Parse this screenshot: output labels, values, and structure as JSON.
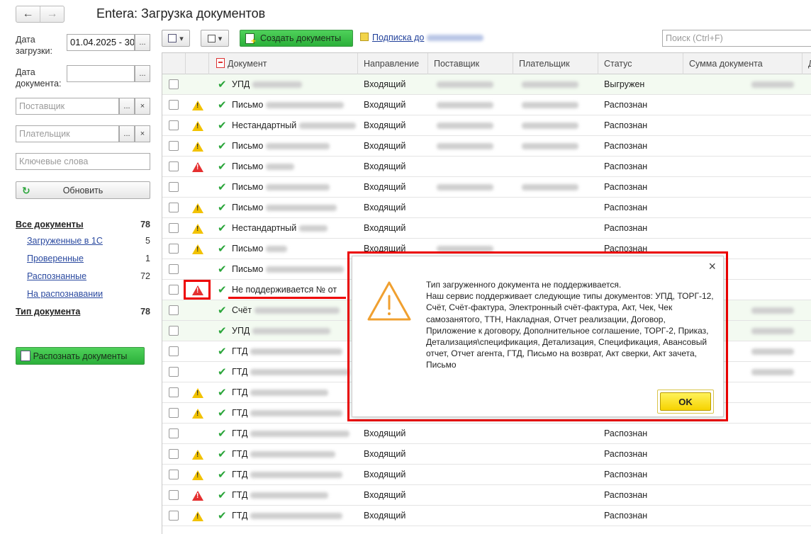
{
  "app": {
    "title": "Entera: Загрузка документов"
  },
  "filters": {
    "upload_date_label": "Дата загрузки:",
    "upload_date_value": "01.04.2025 - 30",
    "doc_date_label": "Дата документа:",
    "doc_date_value": "",
    "supplier_placeholder": "Поставщик",
    "payer_placeholder": "Плательщик",
    "keywords_placeholder": "Ключевые слова",
    "refresh_label": "Обновить",
    "ellipsis": "...",
    "clear": "×"
  },
  "nav": {
    "all_docs": {
      "label": "Все документы",
      "count": "78"
    },
    "items": [
      {
        "label": "Загруженные в 1С",
        "count": "5"
      },
      {
        "label": "Проверенные",
        "count": "1"
      },
      {
        "label": "Распознанные",
        "count": "72"
      },
      {
        "label": "На распознавании",
        "count": ""
      }
    ],
    "doc_type": {
      "label": "Тип документа",
      "count": "78"
    },
    "recognize_label": "Распознать документы"
  },
  "toolbar": {
    "create_label": "Создать документы",
    "subscription_label": "Подписка до",
    "search_placeholder": "Поиск (Ctrl+F)"
  },
  "grid": {
    "columns": [
      "Документ",
      "Направление",
      "Поставщик",
      "Плательщик",
      "Статус",
      "Сумма документа",
      "Д"
    ],
    "rows": [
      {
        "icon": "",
        "doc": "УПД",
        "direction": "Входящий",
        "status": "Выгружен",
        "green": true
      },
      {
        "icon": "warn",
        "doc": "Письмо",
        "direction": "Входящий",
        "status": "Распознан",
        "green": false
      },
      {
        "icon": "warn",
        "doc": "Нестандартный",
        "direction": "Входящий",
        "status": "Распознан",
        "green": false
      },
      {
        "icon": "warn",
        "doc": "Письмо",
        "direction": "Входящий",
        "status": "Распознан",
        "green": false
      },
      {
        "icon": "err",
        "doc": "Письмо",
        "direction": "Входящий",
        "status": "Распознан",
        "green": false
      },
      {
        "icon": "",
        "doc": "Письмо",
        "direction": "Входящий",
        "status": "Распознан",
        "green": false
      },
      {
        "icon": "warn",
        "doc": "Письмо",
        "direction": "Входящий",
        "status": "Распознан",
        "green": false
      },
      {
        "icon": "warn",
        "doc": "Нестандартный",
        "direction": "Входящий",
        "status": "Распознан",
        "green": false
      },
      {
        "icon": "warn",
        "doc": "Письмо",
        "direction": "Входящий",
        "status": "Распознан",
        "green": false
      },
      {
        "icon": "",
        "doc": "Письмо",
        "direction": "",
        "status": "",
        "green": false
      },
      {
        "icon": "err",
        "doc": "Не поддерживается № от",
        "direction": "",
        "status": "",
        "green": false
      },
      {
        "icon": "",
        "doc": "Счёт",
        "direction": "",
        "status": "",
        "green": true
      },
      {
        "icon": "",
        "doc": "УПД",
        "direction": "",
        "status": "",
        "green": true
      },
      {
        "icon": "",
        "doc": "ГТД",
        "direction": "",
        "status": "",
        "green": false
      },
      {
        "icon": "",
        "doc": "ГТД",
        "direction": "",
        "status": "",
        "green": false
      },
      {
        "icon": "warn",
        "doc": "ГТД",
        "direction": "",
        "status": "",
        "green": false
      },
      {
        "icon": "warn",
        "doc": "ГТД",
        "direction": "",
        "status": "",
        "green": false
      },
      {
        "icon": "",
        "doc": "ГТД",
        "direction": "Входящий",
        "status": "Распознан",
        "green": false
      },
      {
        "icon": "warn",
        "doc": "ГТД",
        "direction": "Входящий",
        "status": "Распознан",
        "green": false
      },
      {
        "icon": "warn",
        "doc": "ГТД",
        "direction": "Входящий",
        "status": "Распознан",
        "green": false
      },
      {
        "icon": "err",
        "doc": "ГТД",
        "direction": "Входящий",
        "status": "Распознан",
        "green": false
      },
      {
        "icon": "warn",
        "doc": "ГТД",
        "direction": "Входящий",
        "status": "Распознан",
        "green": false
      }
    ]
  },
  "dialog": {
    "message": "Тип загруженного документа не поддерживается.\nНаш сервис поддерживает следующие типы документов: УПД, ТОРГ-12, Счёт, Счёт-фактура, Электронный счёт-фактура, Акт, Чек, Чек самозанятого, ТТН, Накладная, Отчет реализации, Договор, Приложение к договору, Дополнительное соглашение, ТОРГ-2, Приказ, Детализация\\спецификация, Детализация, Спецификация, Авансовый отчет, Отчет агента, ГТД, Письмо на возврат, Акт сверки, Акт зачета, Письмо",
    "ok_label": "OK",
    "close": "×"
  },
  "colors": {
    "accent_green": "#2bb03a",
    "highlight_red": "#e00000",
    "ok_yellow": "#f6d300"
  }
}
